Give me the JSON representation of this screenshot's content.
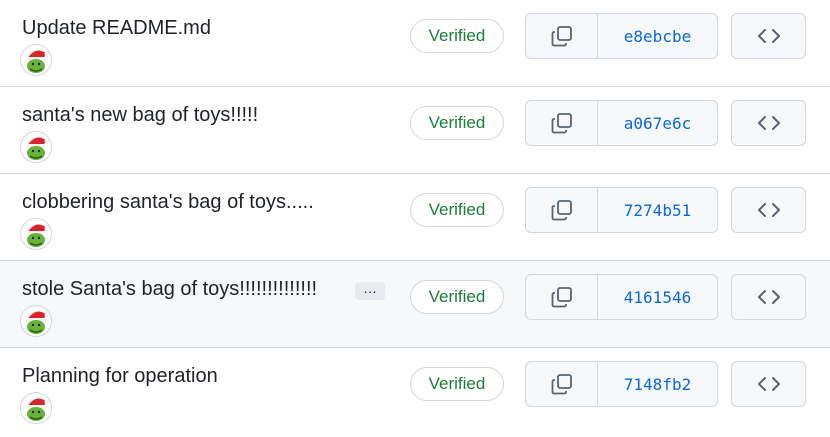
{
  "commits": [
    {
      "message": "Update README.md",
      "verified": "Verified",
      "sha": "e8ebcbe"
    },
    {
      "message": "santa's new bag of toys!!!!!",
      "verified": "Verified",
      "sha": "a067e6c"
    },
    {
      "message": "clobbering santa's bag of toys.....",
      "verified": "Verified",
      "sha": "7274b51"
    },
    {
      "message": "stole Santa's bag of toys!!!!!!!!!!!!!!",
      "verified": "Verified",
      "sha": "4161546",
      "more": "…"
    },
    {
      "message": "Planning for operation",
      "verified": "Verified",
      "sha": "7148fb2"
    }
  ],
  "icons": {
    "copy": "copy-icon",
    "browse": "code-icon",
    "avatar": "grinch-avatar"
  },
  "colors": {
    "verified": "#1a7f37",
    "sha": "#0969da",
    "border": "#d0d7de",
    "hover_row": "#f6f8fa"
  }
}
